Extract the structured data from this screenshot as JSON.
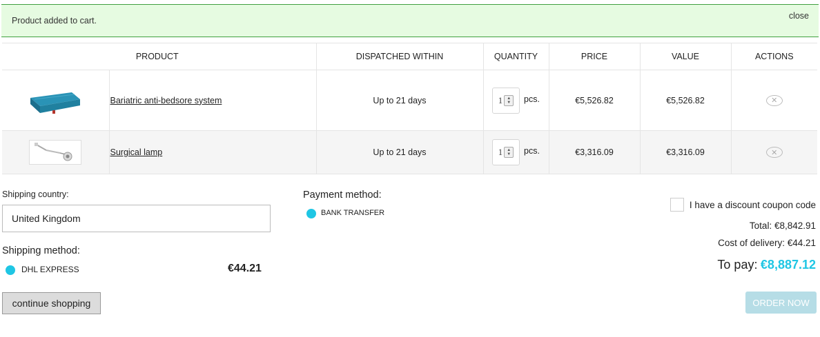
{
  "alert": {
    "message": "Product added to cart.",
    "close_label": "close"
  },
  "table": {
    "headers": [
      "PRODUCT",
      "DISPATCHED WITHIN",
      "QUANTITY",
      "PRICE",
      "VALUE",
      "ACTIONS"
    ],
    "rows": [
      {
        "name": "Bariatric anti-bedsore system",
        "dispatch": "Up to 21 days",
        "qty": "1",
        "unit": "pcs.",
        "price": "€5,526.82",
        "value": "€5,526.82"
      },
      {
        "name": "Surgical lamp",
        "dispatch": "Up to 21 days",
        "qty": "1",
        "unit": "pcs.",
        "price": "€3,316.09",
        "value": "€3,316.09"
      }
    ]
  },
  "shipping": {
    "country_label": "Shipping country:",
    "country_value": "United Kingdom",
    "method_label": "Shipping method:",
    "method_name": "DHL EXPRESS",
    "method_price": "€44.21"
  },
  "payment": {
    "label": "Payment method:",
    "option": "BANK TRANSFER"
  },
  "summary": {
    "coupon_label": "I have a discount coupon code",
    "total": "Total: €8,842.91",
    "delivery": "Cost of delivery: €44.21",
    "to_pay_label": "To pay:",
    "to_pay_value": "€8,887.12"
  },
  "buttons": {
    "continue": "continue shopping",
    "order": "ORDER NOW"
  },
  "colors": {
    "accent": "#1fc6e4",
    "alert_bg": "#e6fbe1",
    "alert_border": "#3e9e3e",
    "order_btn": "#b6dde6"
  }
}
